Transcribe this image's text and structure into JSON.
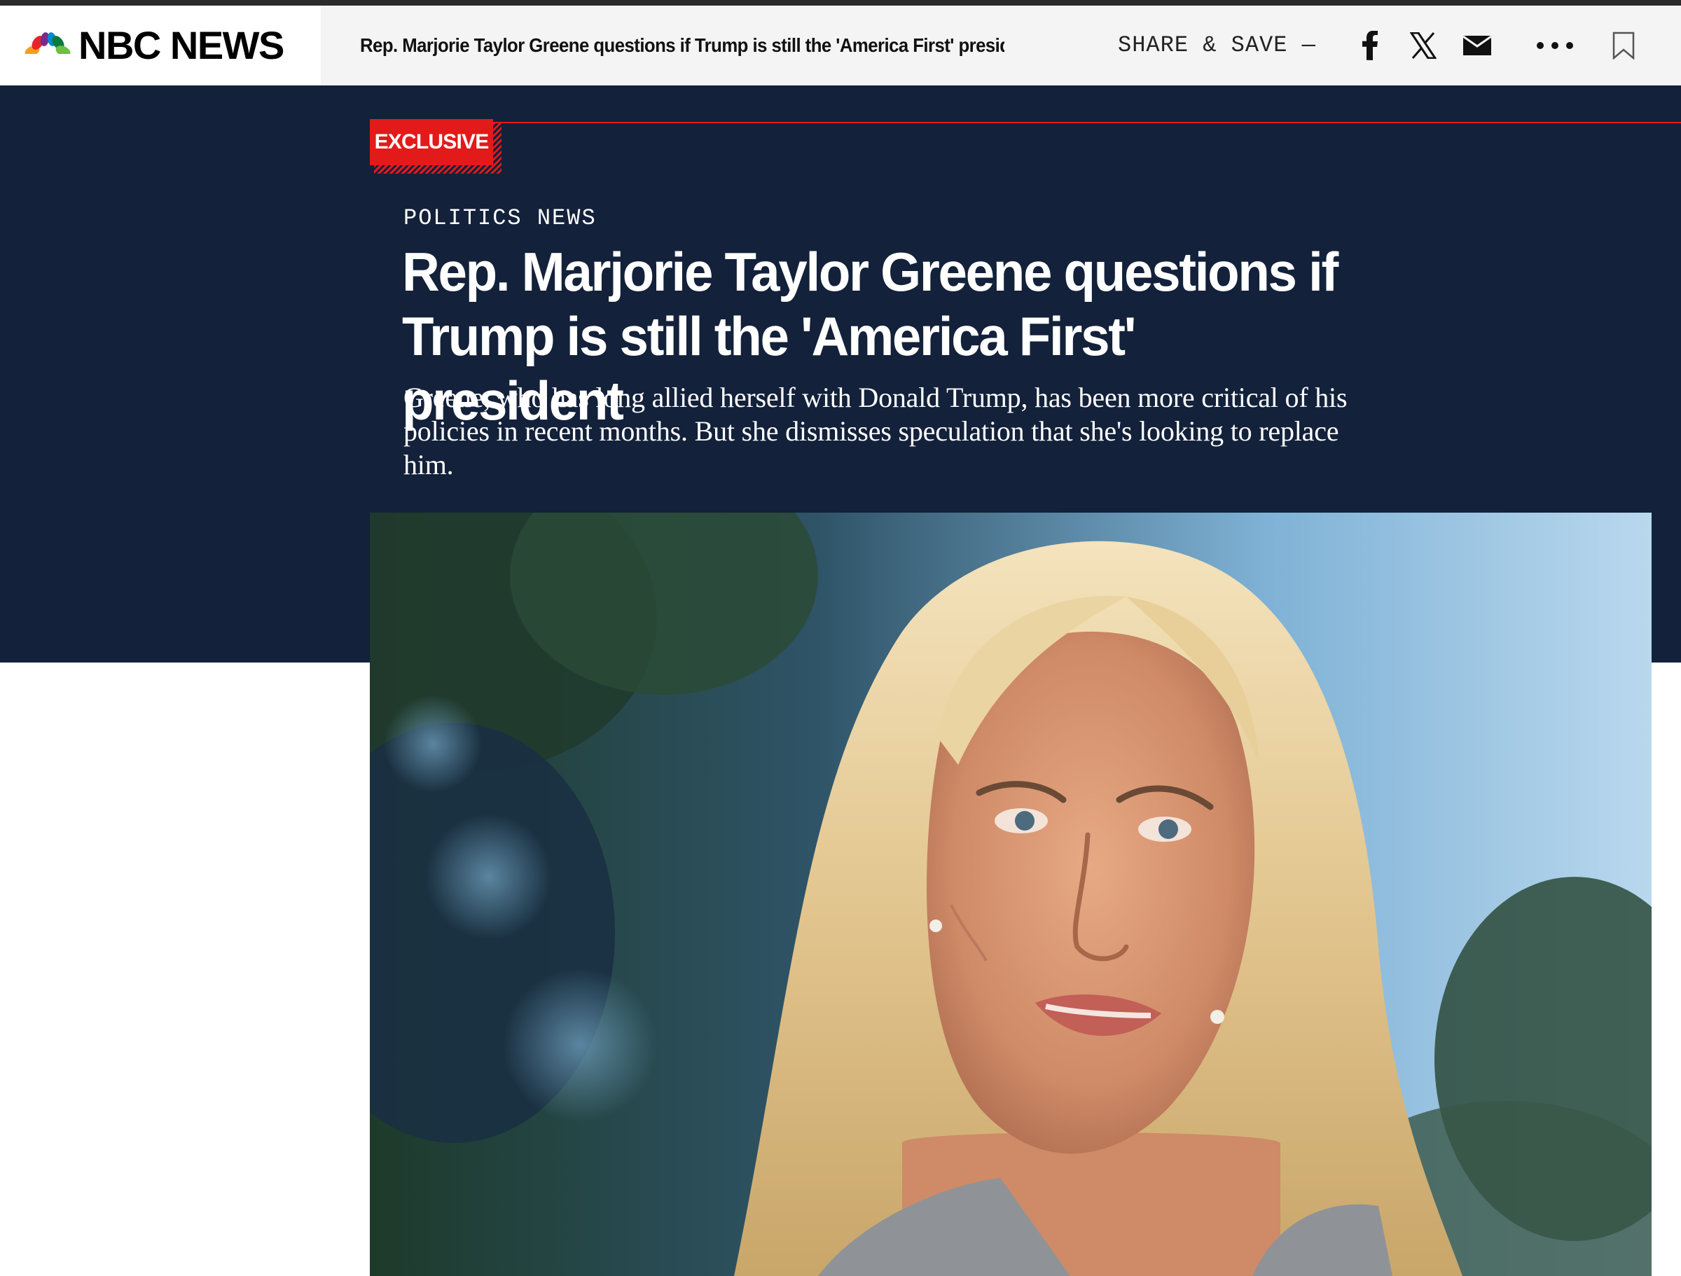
{
  "header": {
    "logo_text": "NBC NEWS",
    "article_title": "Rep. Marjorie Taylor Greene questions if Trump is still the 'America First' president",
    "share_label": "SHARE & SAVE —",
    "icons": [
      "facebook-icon",
      "x-icon",
      "email-icon",
      "more-icon",
      "bookmark-icon"
    ]
  },
  "article": {
    "badge": "EXCLUSIVE",
    "section": "POLITICS NEWS",
    "headline_line1": "Rep. Marjorie Taylor Greene questions if",
    "headline_line2": "Trump is still the 'America First' president",
    "dek": "Greene, who has long allied herself with Donald Trump, has been more critical of his policies in recent months. But she dismisses speculation that she's looking to replace him."
  },
  "colors": {
    "hero_background": "#13213a",
    "accent_red": "#e31a1a",
    "header_background": "#f4f4f4"
  }
}
